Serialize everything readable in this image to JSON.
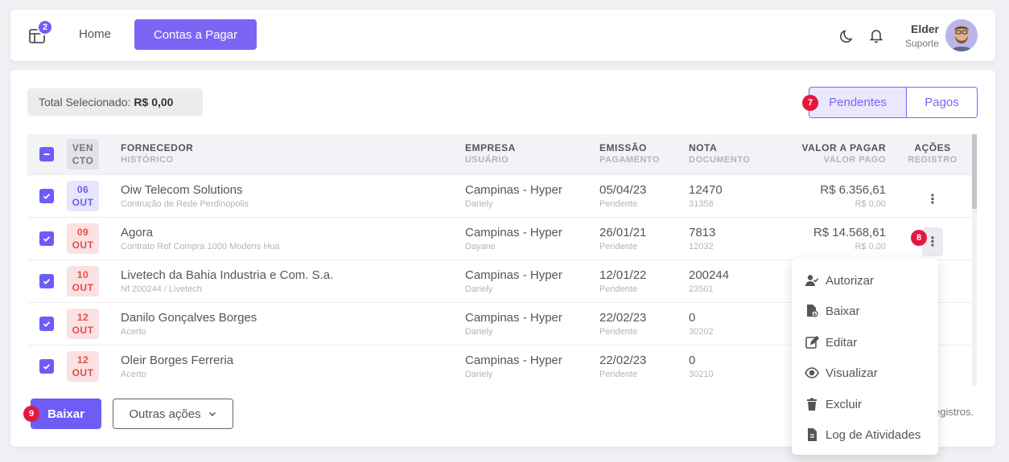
{
  "navbar": {
    "badge_count": "2",
    "home_label": "Home",
    "active_label": "Contas a Pagar",
    "user_name": "Elder",
    "user_role": "Suporte"
  },
  "summary": {
    "total_label": "Total Selecionado:",
    "total_value": "R$ 0,00"
  },
  "filter": {
    "pending_label": "Pendentes",
    "paid_label": "Pagos",
    "pending_step": "7"
  },
  "table": {
    "headers": {
      "venc_top": "VEN",
      "venc_bottom": "CTO",
      "fornecedor": "FORNECEDOR",
      "historico": "HISTÓRICO",
      "empresa": "EMPRESA",
      "usuario": "USUÁRIO",
      "emissao": "EMISSÃO",
      "pagamento": "PAGAMENTO",
      "nota": "NOTA",
      "documento": "DOCUMENTO",
      "valor_pagar": "VALOR A PAGAR",
      "valor_pago": "VALOR PAGO",
      "acoes": "AÇÕES",
      "registro": "REGISTRO"
    },
    "rows": [
      {
        "day": "06",
        "month": "OUT",
        "fornecedor": "Oiw Telecom Solutions",
        "historico": "Contrução de Rede Perdinopolis",
        "empresa": "Campinas - Hyper",
        "usuario": "Dariely",
        "emissao": "05/04/23",
        "pagamento": "Pendente",
        "nota": "12470",
        "documento": "31358",
        "valor": "R$ 6.356,61",
        "pago": "R$ 0,00"
      },
      {
        "day": "09",
        "month": "OUT",
        "fornecedor": "Agora",
        "historico": "Contrato Ref Compra 1000 Modens Hua",
        "empresa": "Campinas - Hyper",
        "usuario": "Dayane",
        "emissao": "26/01/21",
        "pagamento": "Pendente",
        "nota": "7813",
        "documento": "12032",
        "valor": "R$ 14.568,61",
        "pago": "R$ 0,00"
      },
      {
        "day": "10",
        "month": "OUT",
        "fornecedor": "Livetech da Bahia Industria e Com. S.a.",
        "historico": "Nf 200244 / Livetech",
        "empresa": "Campinas - Hyper",
        "usuario": "Dariely",
        "emissao": "12/01/22",
        "pagamento": "Pendente",
        "nota": "200244",
        "documento": "23501"
      },
      {
        "day": "12",
        "month": "OUT",
        "fornecedor": "Danilo Gonçalves Borges",
        "historico": "Acerto",
        "empresa": "Campinas - Hyper",
        "usuario": "Dariely",
        "emissao": "22/02/23",
        "pagamento": "Pendente",
        "nota": "0",
        "documento": "30202"
      },
      {
        "day": "12",
        "month": "OUT",
        "fornecedor": "Oleir Borges Ferreria",
        "historico": "Acerto",
        "empresa": "Campinas - Hyper",
        "usuario": "Dariely",
        "emissao": "22/02/23",
        "pagamento": "Pendente",
        "nota": "0",
        "documento": "30210"
      }
    ],
    "row_step": "8"
  },
  "actions_menu": {
    "items": [
      "Autorizar",
      "Baixar",
      "Editar",
      "Visualizar",
      "Excluir",
      "Log de Atividades"
    ]
  },
  "footer": {
    "baixar_label": "Baixar",
    "baixar_step": "9",
    "outras_label": "Outras ações",
    "registros_text": "egistros."
  },
  "colors": {
    "accent": "#7b65f4",
    "danger": "#e5173f"
  }
}
